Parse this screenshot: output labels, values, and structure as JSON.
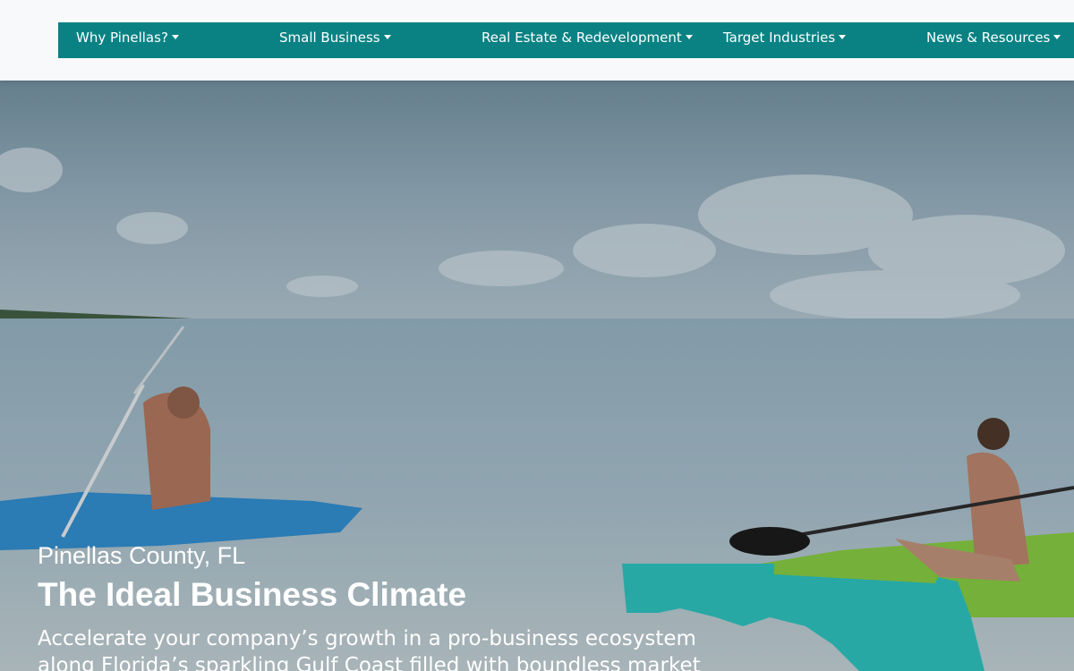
{
  "nav": {
    "items": [
      {
        "label": "Why Pinellas?"
      },
      {
        "label": "Small Business"
      },
      {
        "label": "Real Estate & Redevelopment"
      },
      {
        "label": "Target Industries"
      },
      {
        "label": "News & Resources"
      }
    ]
  },
  "hero": {
    "subtitle": "Pinellas County, FL",
    "headline": "The Ideal Business Climate",
    "lead": "Accelerate your company’s growth in a pro-business ecosystem along Florida’s sparkling Gulf Coast filled with boundless market"
  },
  "colors": {
    "nav_background": "#0a8284",
    "topbar_background": "#f8f9fa",
    "florida_map": "#2bb7b3",
    "text_light": "#ffffff"
  },
  "icons": {
    "dropdown": "caret-down-icon",
    "map": "florida-map-icon"
  }
}
